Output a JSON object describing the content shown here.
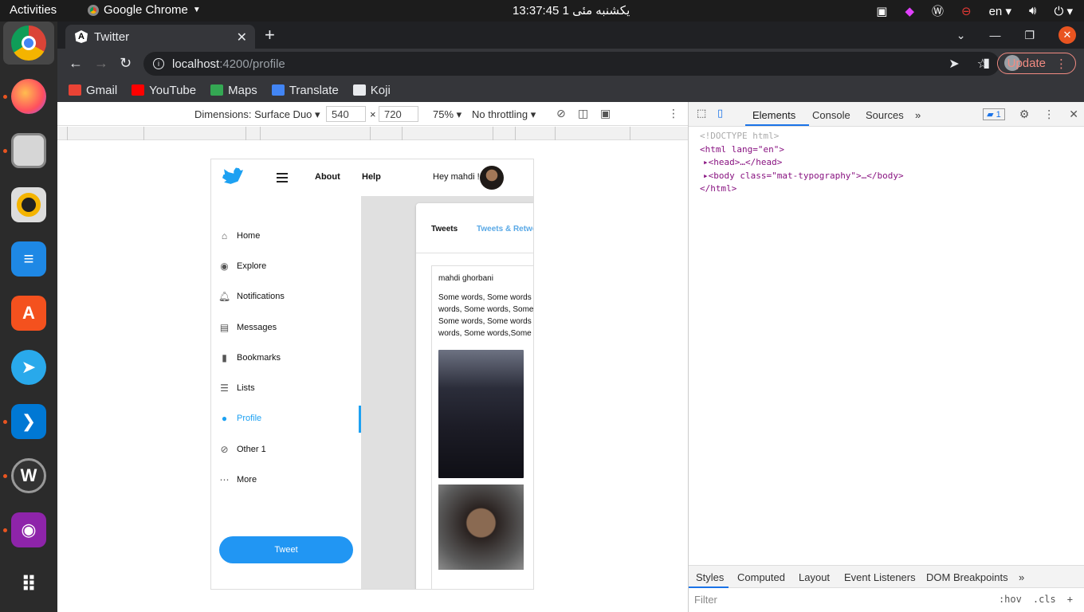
{
  "topbar": {
    "activities": "Activities",
    "app_name": "Google Chrome",
    "clock": "یکشنبه مئی 1  13:37:45",
    "lang": "en"
  },
  "browser": {
    "tab_title": "Twitter",
    "url_host": "localhost",
    "url_path": ":4200/profile",
    "update_label": "Update",
    "bookmarks": [
      "Gmail",
      "YouTube",
      "Maps",
      "Translate",
      "Koji"
    ]
  },
  "devbar": {
    "dimensions": "Dimensions: Surface Duo",
    "width": "540",
    "height": "720",
    "zoom": "75%",
    "throttling": "No throttling"
  },
  "page": {
    "header_links": [
      "About",
      "Help"
    ],
    "greeting": "Hey mahdi !",
    "nav": [
      {
        "label": "Home",
        "icon": "home-icon"
      },
      {
        "label": "Explore",
        "icon": "explore-icon"
      },
      {
        "label": "Notifications",
        "icon": "bell-icon"
      },
      {
        "label": "Messages",
        "icon": "message-icon"
      },
      {
        "label": "Bookmarks",
        "icon": "bookmark-icon"
      },
      {
        "label": "Lists",
        "icon": "list-icon"
      },
      {
        "label": "Profile",
        "icon": "person-icon"
      },
      {
        "label": "Other 1",
        "icon": "block-icon"
      },
      {
        "label": "More",
        "icon": "more-icon"
      }
    ],
    "active_nav": "Profile",
    "tweet_button": "Tweet",
    "tabs": [
      "Tweets",
      "Tweets & Retwe"
    ],
    "tweet": {
      "author": "mahdi ghorbani",
      "text": "Some words, Some words\nwords, Some words, Some\nSome words, Some words\nwords, Some words,Some"
    },
    "accent": "#1da1f2"
  },
  "devtools": {
    "tabs": [
      "Elements",
      "Console",
      "Sources"
    ],
    "issues_count": "1",
    "dom_lines": [
      "<!DOCTYPE html>",
      "<html lang=\"en\">",
      "<head>…</head>",
      "<body class=\"mat-typography\">…</body>",
      "</html>"
    ],
    "styles_tabs": [
      "Styles",
      "Computed",
      "Layout",
      "Event Listeners",
      "DOM Breakpoints"
    ],
    "filter_placeholder": "Filter",
    "hov": ":hov",
    "cls": ".cls"
  }
}
